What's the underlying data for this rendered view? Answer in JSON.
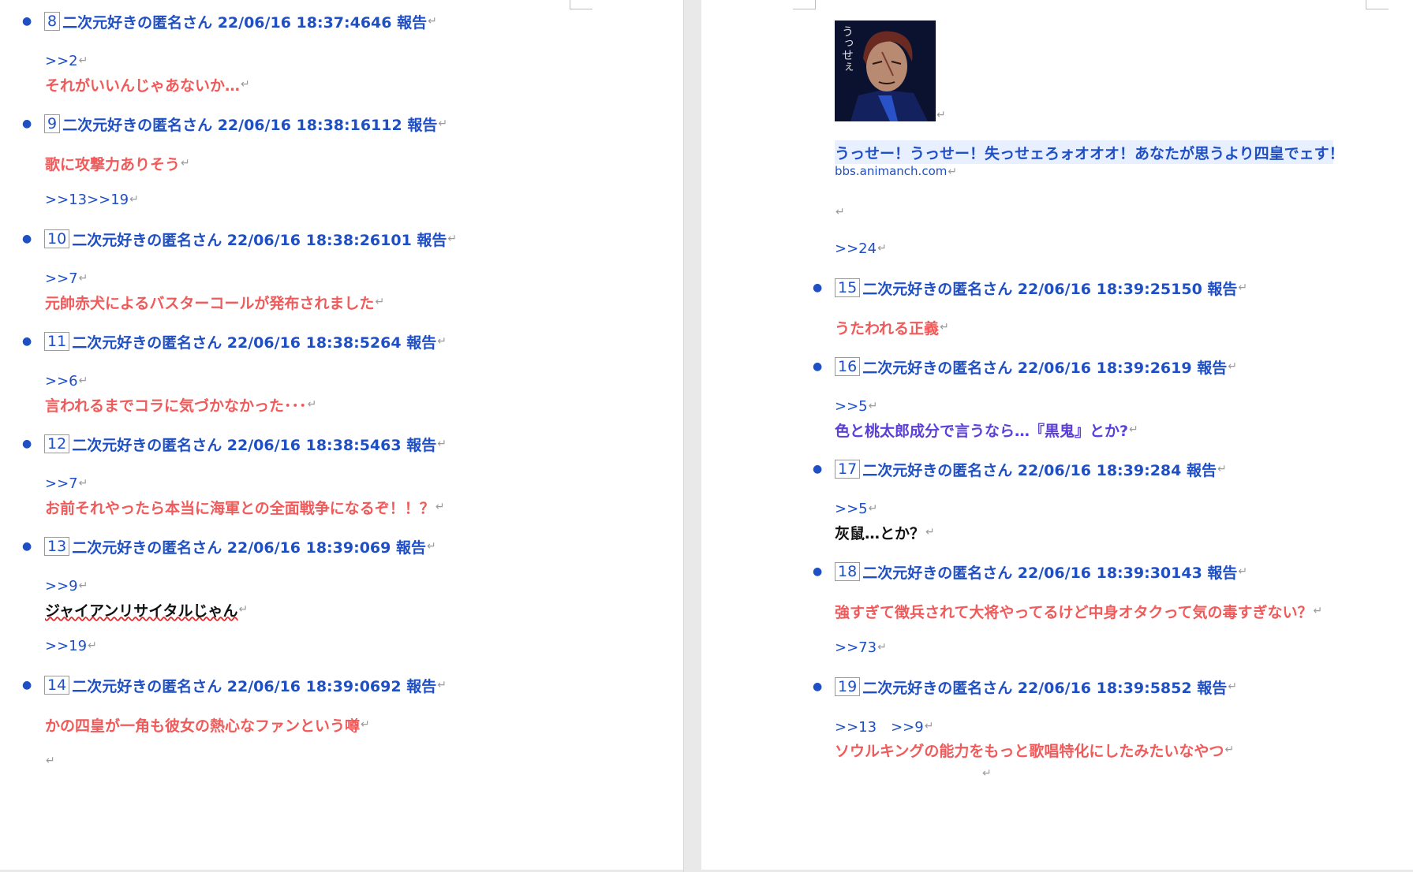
{
  "ui": {
    "para_mark": "↵",
    "bullet": "●"
  },
  "left": {
    "posts": [
      {
        "num": "8",
        "header": "二次元好きの匿名さん 22/06/16 18:37:4646 報告",
        "lines": [
          {
            "kind": "ref",
            "text": ">>2"
          },
          {
            "kind": "red",
            "text": "それがいいんじゃあないか…"
          }
        ]
      },
      {
        "num": "9",
        "header": "二次元好きの匿名さん 22/06/16 18:38:16112 報告",
        "lines": [
          {
            "kind": "red",
            "text": "歌に攻撃力ありそう"
          },
          {
            "kind": "ref",
            "text": ">>13>>19"
          }
        ]
      },
      {
        "num": "10",
        "header": "二次元好きの匿名さん 22/06/16 18:38:26101 報告",
        "lines": [
          {
            "kind": "ref",
            "text": ">>7"
          },
          {
            "kind": "red",
            "text": "元帥赤犬によるバスターコールが発布されました"
          }
        ]
      },
      {
        "num": "11",
        "header": "二次元好きの匿名さん 22/06/16 18:38:5264 報告",
        "lines": [
          {
            "kind": "ref",
            "text": ">>6"
          },
          {
            "kind": "red",
            "text": "言われるまでコラに気づかなかった･･･"
          }
        ]
      },
      {
        "num": "12",
        "header": "二次元好きの匿名さん 22/06/16 18:38:5463 報告",
        "lines": [
          {
            "kind": "ref",
            "text": ">>7"
          },
          {
            "kind": "red",
            "text": "お前それやったら本当に海軍との全面戦争になるぞ！！？"
          }
        ]
      },
      {
        "num": "13",
        "header": "二次元好きの匿名さん 22/06/16 18:39:069 報告",
        "lines": [
          {
            "kind": "ref",
            "text": ">>9"
          },
          {
            "kind": "black",
            "text": "ジャイアンリサイタルじゃん"
          },
          {
            "kind": "ref",
            "text": ">>19"
          }
        ]
      },
      {
        "num": "14",
        "header": "二次元好きの匿名さん 22/06/16 18:39:0692 報告",
        "lines": [
          {
            "kind": "red",
            "text": "かの四皇が一角も彼女の熱心なファンという噂"
          }
        ]
      }
    ]
  },
  "right": {
    "image_alt": "うっせぇ",
    "quote": "うっせー！うっせー！失っせェろォオオオ！あなたが思うより四皇でェす！",
    "link": "bbs.animanch.com",
    "ref_top": ">>24",
    "posts": [
      {
        "num": "15",
        "header": "二次元好きの匿名さん 22/06/16 18:39:25150 報告",
        "lines": [
          {
            "kind": "red",
            "text": "うたわれる正義"
          }
        ]
      },
      {
        "num": "16",
        "header": "二次元好きの匿名さん 22/06/16 18:39:2619 報告",
        "lines": [
          {
            "kind": "ref",
            "text": ">>5"
          },
          {
            "kind": "purple",
            "text": "色と桃太郎成分で言うなら…『黒鬼』とか?"
          }
        ]
      },
      {
        "num": "17",
        "header": "二次元好きの匿名さん 22/06/16 18:39:284 報告",
        "lines": [
          {
            "kind": "ref",
            "text": ">>5"
          },
          {
            "kind": "black",
            "text": "灰鼠…とか？"
          }
        ]
      },
      {
        "num": "18",
        "header": "二次元好きの匿名さん 22/06/16 18:39:30143 報告",
        "lines": [
          {
            "kind": "red",
            "text": "強すぎて徴兵されて大将やってるけど中身オタクって気の毒すぎない？"
          },
          {
            "kind": "ref",
            "text": ">>73"
          }
        ]
      },
      {
        "num": "19",
        "header": "二次元好きの匿名さん 22/06/16 18:39:5852 報告",
        "lines": [
          {
            "kind": "ref",
            "text": ">>13　>>9"
          },
          {
            "kind": "red",
            "text": "ソウルキングの能力をもっと歌唱特化にしたみたいなやつ"
          }
        ]
      }
    ]
  }
}
